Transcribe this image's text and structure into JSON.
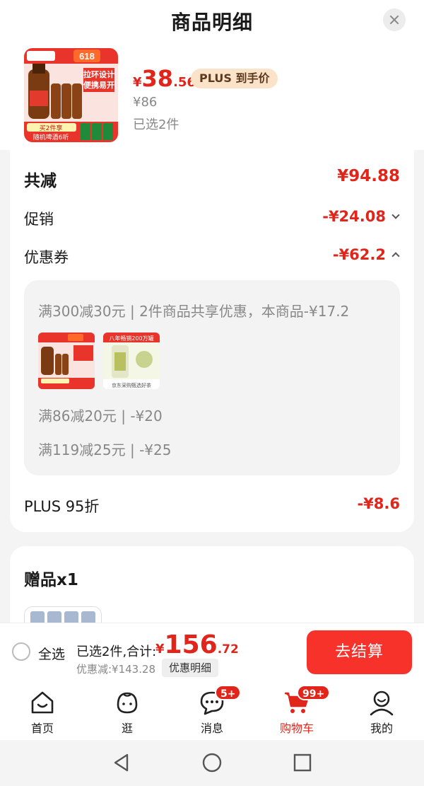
{
  "header": {
    "title": "商品明细"
  },
  "product": {
    "price_yen": "¥",
    "price_int": "38",
    "price_dec": ".56",
    "plus_tag": "PLUS 到手价",
    "original_price": "¥86",
    "selected_count": "已选2件",
    "thumb_badge": "618",
    "thumb_text_1": "拉环设计",
    "thumb_text_2": "便携易开",
    "thumb_promo_1": "买2件享",
    "thumb_promo_2": "随机啤酒6听"
  },
  "discount": {
    "total_label": "共减",
    "total_value": "¥94.88",
    "promo_label": "促销",
    "promo_value": "-¥24.08",
    "coupon_label": "优惠券",
    "coupon_value": "-¥62.2",
    "coupon_lines": [
      "满300减30元 | 2件商品共享优惠，本商品-¥17.2",
      "满86减20元 | -¥20",
      "满119减25元 | -¥25"
    ],
    "mini2_text": "八年畅销200万罐",
    "mini2_sub": "京东采购甄选好茶",
    "plus_label": "PLUS 95折",
    "plus_value": "-¥8.6"
  },
  "gift": {
    "title": "赠品x1"
  },
  "checkout": {
    "select_all": "全选",
    "summary": "已选2件,合计:",
    "total_yen": "¥",
    "total_int": "156",
    "total_dec": ".72",
    "saved": "优惠减:¥143.28",
    "detail_button": "优惠明细",
    "checkout_button": "去结算"
  },
  "tabbar": {
    "items": [
      {
        "label": "首页",
        "icon": "home-icon"
      },
      {
        "label": "逛",
        "icon": "face-icon"
      },
      {
        "label": "消息",
        "icon": "chat-icon",
        "badge": "5+"
      },
      {
        "label": "购物车",
        "icon": "cart-icon",
        "badge": "99+",
        "active": true
      },
      {
        "label": "我的",
        "icon": "user-icon"
      }
    ]
  },
  "colors": {
    "accent": "#e1251b",
    "plus_tag_bg": "#fbe3c9",
    "checkout_button": "#f6322b"
  }
}
